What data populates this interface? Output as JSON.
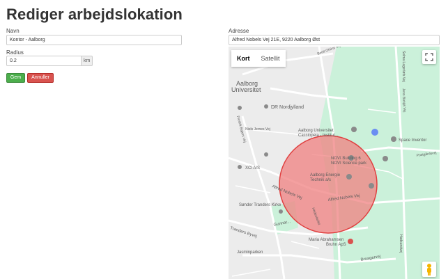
{
  "page": {
    "title": "Rediger arbejdslokation"
  },
  "form": {
    "name_label": "Navn",
    "name_value": "Kontor - Aalborg",
    "radius_label": "Radius",
    "radius_value": "0.2",
    "radius_unit": "km",
    "address_label": "Adresse",
    "address_value": "Alfred Nobels Vej 21E, 9220 Aalborg Øst",
    "save_label": "Gem",
    "cancel_label": "Annuller"
  },
  "map": {
    "type_buttons": [
      "Kort",
      "Satellit"
    ],
    "active_type": "Kort",
    "circle_color": "#f08080",
    "park_color": "#c8f0d8",
    "labels": {
      "aalborg_uni_1": "Aalborg",
      "aalborg_uni_2": "Universitet",
      "dr": "DR Nordjylland",
      "niels_jernes": "Niels Jernes Vej",
      "aau_cassiopeia_1": "Aalborg Universitet",
      "aau_cassiopeia_2": "Cassiopeia - Institut...",
      "space_inventor": "Space Inventor",
      "novi_1": "NOVI Building 6",
      "novi_2": "NOVI Science park",
      "xci": "XCI A/S",
      "aalborg_energie_1": "Aalborg Energie",
      "aalborg_energie_2": "Technik a/s",
      "alfred_nobels_1": "Alfred Nobels Vej",
      "alfred_nobels_2": "Alfred Nobels Vej",
      "sonder_tranders": "Sønder Tranders Kirke",
      "tranders_byvej": "Tranders Byvej",
      "gunnar": "Gunnar...",
      "hedeskellet": "Hedeskellet",
      "maria": "Maria Abrahamsen",
      "bruhn": "Bruhn ApS",
      "jasmin": "Jasminparken",
      "broagervej": "Broagervej",
      "bertil": "Bertil Ohlins Vej",
      "selma": "Selma Lagerløfs Vej",
      "fredrik": "Fredrik Bajers Vej",
      "postgaards": "Postgårdsvej",
      "hadsundvej": "Hadsundvej",
      "jens": "Jens Bangs Vej"
    }
  }
}
